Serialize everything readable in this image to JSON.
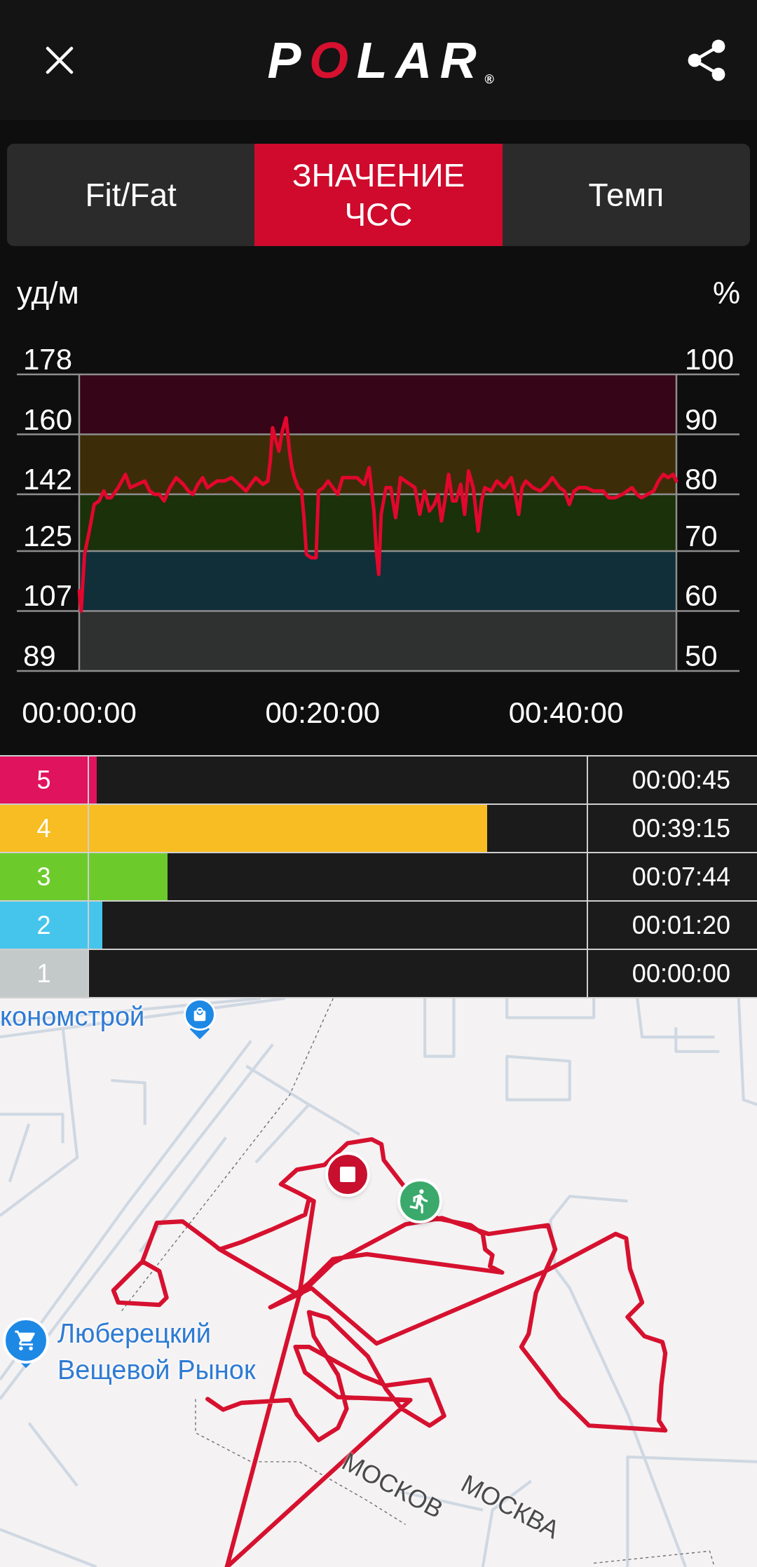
{
  "header": {
    "logo": "POLAR",
    "logo_mark": "®"
  },
  "tabs": [
    {
      "label": "Fit/Fat",
      "selected": false
    },
    {
      "label": "ЗНАЧЕНИЕ ЧСС",
      "selected": true
    },
    {
      "label": "Темп",
      "selected": false
    }
  ],
  "heart_rate_chart": {
    "right_axis": {
      "unit": "%",
      "ticks": [
        "100",
        "90",
        "80",
        "70",
        "60",
        "50"
      ]
    },
    "chart_data": {
      "type": "line",
      "ylabel": "уд/м",
      "grid": true,
      "x": [
        0,
        0.16,
        0.44,
        0.83,
        1.23,
        1.63,
        2.02,
        2.3,
        2.62,
        3.2,
        3.8,
        4.2,
        4.8,
        5.39,
        5.79,
        6.18,
        6.58,
        6.98,
        7.45,
        7.97,
        8.56,
        8.96,
        9.35,
        9.75,
        10.15,
        10.54,
        10.94,
        11.34,
        11.93,
        12.52,
        13.12,
        13.71,
        14.1,
        14.51,
        15.1,
        15.5,
        15.7,
        15.89,
        16.17,
        16.41,
        16.69,
        17.0,
        17.28,
        17.48,
        17.68,
        17.99,
        18.27,
        18.47,
        18.67,
        19.06,
        19.46,
        19.66,
        20.06,
        20.45,
        20.85,
        21.24,
        21.64,
        22.24,
        22.83,
        23.42,
        23.82,
        24.22,
        24.42,
        24.61,
        24.81,
        25.21,
        25.6,
        26.0,
        26.4,
        26.79,
        27.19,
        27.59,
        27.98,
        28.38,
        28.78,
        29.17,
        29.49,
        29.77,
        30.04,
        30.36,
        30.68,
        30.96,
        31.35,
        31.67,
        31.99,
        32.38,
        32.78,
        33.06,
        33.33,
        33.85,
        34.32,
        34.92,
        35.51,
        35.83,
        36.11,
        36.38,
        36.7,
        37.3,
        37.89,
        38.49,
        38.88,
        39.48,
        39.87,
        40.27,
        40.67,
        41.06,
        41.66,
        42.25,
        43.05,
        43.52,
        44.03,
        44.63,
        45.42,
        45.82,
        46.21,
        46.69,
        47.2,
        47.6,
        48.0,
        48.4,
        48.8,
        49.07
      ],
      "values": [
        113,
        107,
        124,
        131,
        139,
        140,
        143,
        141,
        141,
        144,
        148,
        144,
        145,
        146,
        143,
        142,
        142,
        140,
        144,
        147,
        145,
        143,
        142,
        145,
        147,
        144,
        145,
        146,
        146,
        147,
        145,
        143,
        145,
        147,
        145,
        146,
        152,
        162,
        158,
        155,
        161,
        165,
        155,
        150,
        147,
        144,
        143,
        135,
        124,
        123,
        123,
        143,
        144,
        146,
        144,
        142,
        147,
        147,
        147,
        145,
        150,
        137,
        125,
        118,
        136,
        144,
        144,
        135,
        147,
        146,
        145,
        144,
        136,
        143,
        137,
        139,
        142,
        134,
        140,
        148,
        140,
        140,
        145,
        136,
        149,
        144,
        131,
        140,
        144,
        143,
        146,
        144,
        147,
        142,
        136,
        144,
        146,
        144,
        143,
        145,
        147,
        144,
        143,
        139,
        143,
        144,
        144,
        143,
        143,
        141,
        141,
        142,
        144,
        142,
        141,
        142,
        143,
        146,
        148,
        147,
        148,
        146
      ],
      "xlim": [
        0,
        49.07
      ],
      "ylim": [
        89,
        178
      ],
      "xticks": [
        {
          "value": 0,
          "label": "00:00:00"
        },
        {
          "value": 20,
          "label": "00:20:00"
        },
        {
          "value": 40,
          "label": "00:40:00"
        }
      ],
      "yticks": [
        89,
        107,
        125,
        142,
        160,
        178
      ]
    }
  },
  "zones": [
    {
      "label": "5",
      "color": "#e0135f",
      "level": 0.015,
      "time": "00:00:45"
    },
    {
      "label": "4",
      "color": "#f8bd22",
      "level": 0.8,
      "time": "00:39:15"
    },
    {
      "label": "3",
      "color": "#6ccb2b",
      "level": 0.158,
      "time": "00:07:44"
    },
    {
      "label": "2",
      "color": "#45c5ec",
      "level": 0.027,
      "time": "00:01:20"
    },
    {
      "label": "1",
      "color": "#c3c9c9",
      "time": "00:00:00"
    }
  ],
  "map": {
    "labels": [
      {
        "kind": "place",
        "text": "кономстрой"
      },
      {
        "kind": "place",
        "text": "Люберецкий Вещевой Рынок"
      },
      {
        "kind": "street",
        "text": "МОСКОВ"
      },
      {
        "kind": "street",
        "text": "МОСКВА"
      }
    ]
  }
}
